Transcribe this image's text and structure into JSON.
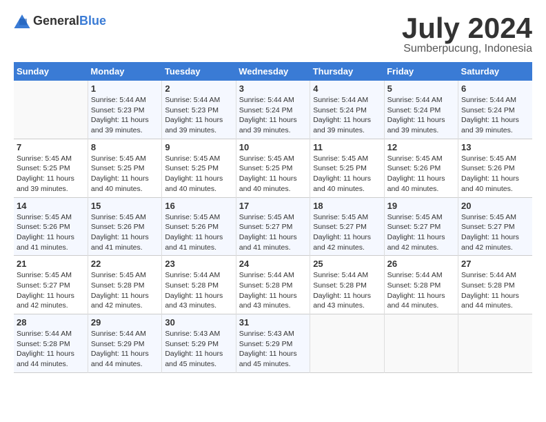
{
  "header": {
    "logo_general": "General",
    "logo_blue": "Blue",
    "month_title": "July 2024",
    "subtitle": "Sumberpucung, Indonesia"
  },
  "days_of_week": [
    "Sunday",
    "Monday",
    "Tuesday",
    "Wednesday",
    "Thursday",
    "Friday",
    "Saturday"
  ],
  "weeks": [
    [
      {
        "day": "",
        "info": ""
      },
      {
        "day": "1",
        "info": "Sunrise: 5:44 AM\nSunset: 5:23 PM\nDaylight: 11 hours\nand 39 minutes."
      },
      {
        "day": "2",
        "info": "Sunrise: 5:44 AM\nSunset: 5:23 PM\nDaylight: 11 hours\nand 39 minutes."
      },
      {
        "day": "3",
        "info": "Sunrise: 5:44 AM\nSunset: 5:24 PM\nDaylight: 11 hours\nand 39 minutes."
      },
      {
        "day": "4",
        "info": "Sunrise: 5:44 AM\nSunset: 5:24 PM\nDaylight: 11 hours\nand 39 minutes."
      },
      {
        "day": "5",
        "info": "Sunrise: 5:44 AM\nSunset: 5:24 PM\nDaylight: 11 hours\nand 39 minutes."
      },
      {
        "day": "6",
        "info": "Sunrise: 5:44 AM\nSunset: 5:24 PM\nDaylight: 11 hours\nand 39 minutes."
      }
    ],
    [
      {
        "day": "7",
        "info": "Sunrise: 5:45 AM\nSunset: 5:25 PM\nDaylight: 11 hours\nand 39 minutes."
      },
      {
        "day": "8",
        "info": "Sunrise: 5:45 AM\nSunset: 5:25 PM\nDaylight: 11 hours\nand 40 minutes."
      },
      {
        "day": "9",
        "info": "Sunrise: 5:45 AM\nSunset: 5:25 PM\nDaylight: 11 hours\nand 40 minutes."
      },
      {
        "day": "10",
        "info": "Sunrise: 5:45 AM\nSunset: 5:25 PM\nDaylight: 11 hours\nand 40 minutes."
      },
      {
        "day": "11",
        "info": "Sunrise: 5:45 AM\nSunset: 5:25 PM\nDaylight: 11 hours\nand 40 minutes."
      },
      {
        "day": "12",
        "info": "Sunrise: 5:45 AM\nSunset: 5:26 PM\nDaylight: 11 hours\nand 40 minutes."
      },
      {
        "day": "13",
        "info": "Sunrise: 5:45 AM\nSunset: 5:26 PM\nDaylight: 11 hours\nand 40 minutes."
      }
    ],
    [
      {
        "day": "14",
        "info": "Sunrise: 5:45 AM\nSunset: 5:26 PM\nDaylight: 11 hours\nand 41 minutes."
      },
      {
        "day": "15",
        "info": "Sunrise: 5:45 AM\nSunset: 5:26 PM\nDaylight: 11 hours\nand 41 minutes."
      },
      {
        "day": "16",
        "info": "Sunrise: 5:45 AM\nSunset: 5:26 PM\nDaylight: 11 hours\nand 41 minutes."
      },
      {
        "day": "17",
        "info": "Sunrise: 5:45 AM\nSunset: 5:27 PM\nDaylight: 11 hours\nand 41 minutes."
      },
      {
        "day": "18",
        "info": "Sunrise: 5:45 AM\nSunset: 5:27 PM\nDaylight: 11 hours\nand 42 minutes."
      },
      {
        "day": "19",
        "info": "Sunrise: 5:45 AM\nSunset: 5:27 PM\nDaylight: 11 hours\nand 42 minutes."
      },
      {
        "day": "20",
        "info": "Sunrise: 5:45 AM\nSunset: 5:27 PM\nDaylight: 11 hours\nand 42 minutes."
      }
    ],
    [
      {
        "day": "21",
        "info": "Sunrise: 5:45 AM\nSunset: 5:27 PM\nDaylight: 11 hours\nand 42 minutes."
      },
      {
        "day": "22",
        "info": "Sunrise: 5:45 AM\nSunset: 5:28 PM\nDaylight: 11 hours\nand 42 minutes."
      },
      {
        "day": "23",
        "info": "Sunrise: 5:44 AM\nSunset: 5:28 PM\nDaylight: 11 hours\nand 43 minutes."
      },
      {
        "day": "24",
        "info": "Sunrise: 5:44 AM\nSunset: 5:28 PM\nDaylight: 11 hours\nand 43 minutes."
      },
      {
        "day": "25",
        "info": "Sunrise: 5:44 AM\nSunset: 5:28 PM\nDaylight: 11 hours\nand 43 minutes."
      },
      {
        "day": "26",
        "info": "Sunrise: 5:44 AM\nSunset: 5:28 PM\nDaylight: 11 hours\nand 44 minutes."
      },
      {
        "day": "27",
        "info": "Sunrise: 5:44 AM\nSunset: 5:28 PM\nDaylight: 11 hours\nand 44 minutes."
      }
    ],
    [
      {
        "day": "28",
        "info": "Sunrise: 5:44 AM\nSunset: 5:28 PM\nDaylight: 11 hours\nand 44 minutes."
      },
      {
        "day": "29",
        "info": "Sunrise: 5:44 AM\nSunset: 5:29 PM\nDaylight: 11 hours\nand 44 minutes."
      },
      {
        "day": "30",
        "info": "Sunrise: 5:43 AM\nSunset: 5:29 PM\nDaylight: 11 hours\nand 45 minutes."
      },
      {
        "day": "31",
        "info": "Sunrise: 5:43 AM\nSunset: 5:29 PM\nDaylight: 11 hours\nand 45 minutes."
      },
      {
        "day": "",
        "info": ""
      },
      {
        "day": "",
        "info": ""
      },
      {
        "day": "",
        "info": ""
      }
    ]
  ]
}
